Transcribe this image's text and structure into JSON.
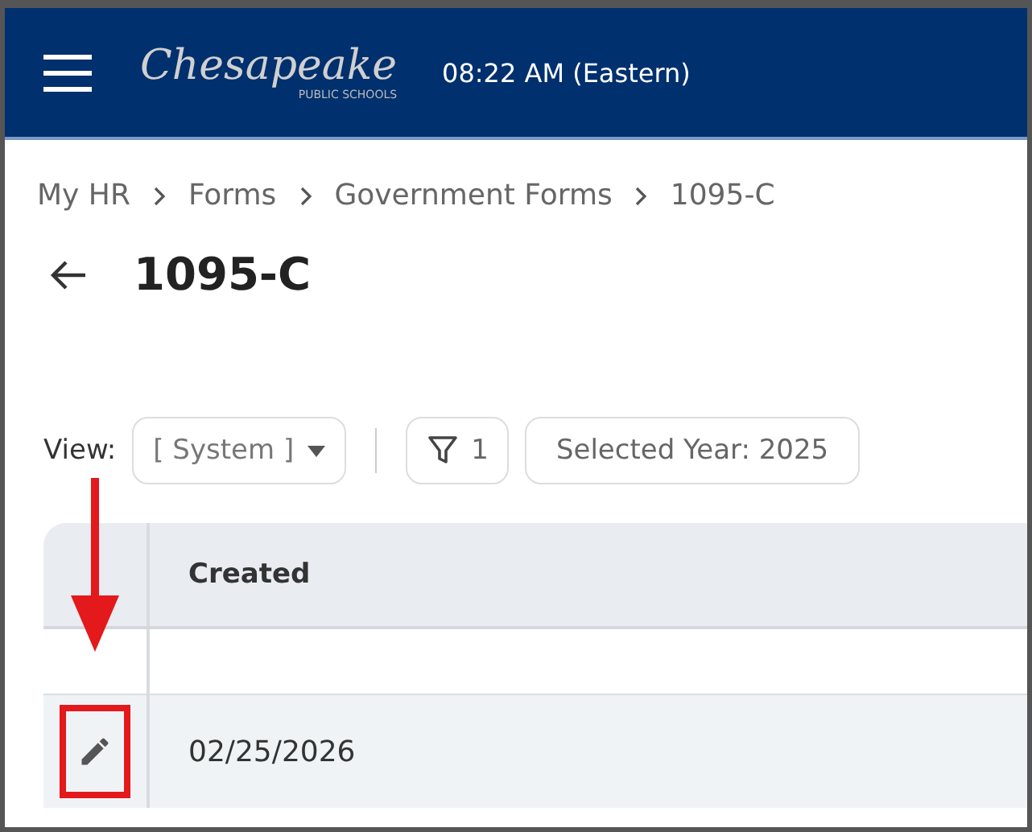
{
  "header": {
    "logo": {
      "name": "Chesapeake",
      "subtitle": "PUBLIC SCHOOLS"
    },
    "time": "08:22 AM (Eastern)"
  },
  "breadcrumbs": [
    "My HR",
    "Forms",
    "Government Forms",
    "1095-C"
  ],
  "page_title": "1095-C",
  "toolbar": {
    "view_label": "View:",
    "view_value": "[ System ]",
    "filter_count": "1",
    "year_chip": "Selected Year: 2025"
  },
  "table": {
    "columns": [
      "Created"
    ],
    "rows": [
      {
        "created": "02/25/2026",
        "highlighted": true
      }
    ]
  }
}
